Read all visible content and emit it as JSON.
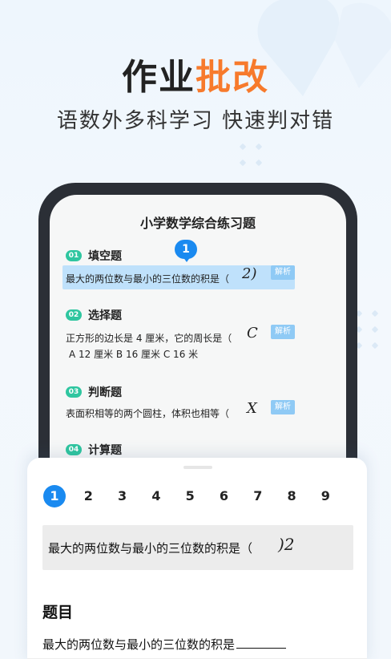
{
  "promo": {
    "headline_main": "作业",
    "headline_accent": "批改",
    "subtitle": "语数外多科学习 快速判对错"
  },
  "paper": {
    "title": "小学数学综合练习题",
    "marker_number": "1",
    "sections": [
      {
        "num": "01",
        "title": "填空题",
        "question": "最大的两位数与最小的三位数的积是（",
        "handwriting": "2)",
        "analysis": "解析"
      },
      {
        "num": "02",
        "title": "选择题",
        "question": "正方形的边长是 4 厘米，它的周长是（",
        "handwriting": "C",
        "options": "A  12 厘米    B  16 厘米    C  16 米",
        "analysis": "解析"
      },
      {
        "num": "03",
        "title": "判断题",
        "question": "表面积相等的两个圆柱，体积也相等（",
        "handwriting": "X",
        "analysis": "解析"
      },
      {
        "num": "04",
        "title": "计算题"
      }
    ]
  },
  "sheet": {
    "question_numbers": [
      "1",
      "2",
      "3",
      "4",
      "5",
      "6",
      "7",
      "8",
      "9"
    ],
    "active_question": 1,
    "crop_text": "最大的两位数与最小的三位数的积是（",
    "crop_handwriting": ")2",
    "section_label": "题目",
    "question_text": "最大的两位数与最小的三位数的积是"
  },
  "colors": {
    "accent_orange": "#f77a2c",
    "primary_blue": "#1a8af0",
    "section_green": "#2fc6a0",
    "highlight_blue": "#bfe1fb"
  }
}
